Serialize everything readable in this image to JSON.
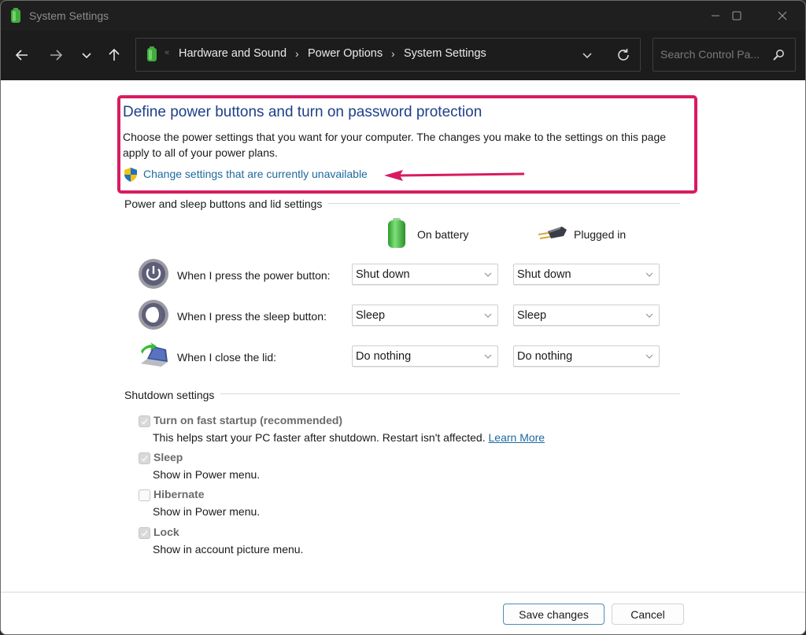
{
  "window": {
    "title": "System Settings",
    "controls": {
      "minimize": "minimize",
      "maximize": "maximize",
      "close": "close"
    }
  },
  "nav": {
    "back_icon": "arrow-left-icon",
    "forward_icon": "arrow-right-icon",
    "recent_icon": "chevron-down-icon",
    "up_icon": "arrow-up-icon",
    "breadcrumb_overflow": "«",
    "breadcrumbs": [
      {
        "label": "Hardware and Sound"
      },
      {
        "label": "Power Options"
      },
      {
        "label": "System Settings"
      }
    ],
    "breadcrumb_separator": "›",
    "search_placeholder": "Search Control Pa..."
  },
  "header": {
    "title": "Define power buttons and turn on password protection",
    "description": "Choose the power settings that you want for your computer. The changes you make to the settings on this page apply to all of your power plans.",
    "unavailable_link": "Change settings that are currently unavailable",
    "highlight_color": "#d81b60"
  },
  "power_section": {
    "label": "Power and sleep buttons and lid settings",
    "columns": [
      {
        "label": "On battery",
        "icon": "battery-icon"
      },
      {
        "label": "Plugged in",
        "icon": "plug-icon"
      }
    ],
    "rows": [
      {
        "label": "When I press the power button:",
        "icon": "power-button-icon",
        "on_battery": "Shut down",
        "plugged_in": "Shut down"
      },
      {
        "label": "When I press the sleep button:",
        "icon": "sleep-button-icon",
        "on_battery": "Sleep",
        "plugged_in": "Sleep"
      },
      {
        "label": "When I close the lid:",
        "icon": "laptop-lid-icon",
        "on_battery": "Do nothing",
        "plugged_in": "Do nothing"
      }
    ]
  },
  "shutdown_section": {
    "label": "Shutdown settings",
    "items": [
      {
        "label": "Turn on fast startup (recommended)",
        "checked": true,
        "description": "This helps start your PC faster after shutdown. Restart isn't affected.",
        "link": "Learn More"
      },
      {
        "label": "Sleep",
        "checked": true,
        "description": "Show in Power menu."
      },
      {
        "label": "Hibernate",
        "checked": false,
        "description": "Show in Power menu."
      },
      {
        "label": "Lock",
        "checked": true,
        "description": "Show in account picture menu."
      }
    ]
  },
  "footer": {
    "save_label": "Save changes",
    "cancel_label": "Cancel"
  }
}
